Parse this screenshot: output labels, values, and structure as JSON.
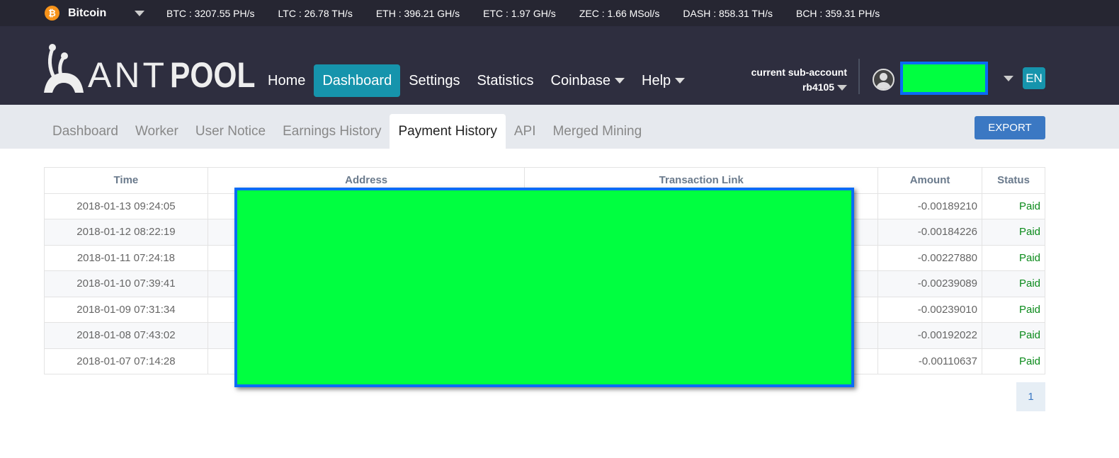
{
  "topbar": {
    "coin": "Bitcoin",
    "rates": [
      "BTC : 3207.55 PH/s",
      "LTC : 26.78 TH/s",
      "ETH : 396.21 GH/s",
      "ETC : 1.97 GH/s",
      "ZEC : 1.66 MSol/s",
      "DASH : 858.31 TH/s",
      "BCH : 359.31 PH/s"
    ]
  },
  "logo": {
    "ant": "ANT",
    "pool": "POOL"
  },
  "nav": {
    "home": "Home",
    "dashboard": "Dashboard",
    "settings": "Settings",
    "statistics": "Statistics",
    "coinbase": "Coinbase",
    "help": "Help"
  },
  "account": {
    "label": "current sub-account",
    "name": "rb4105",
    "lang": "EN"
  },
  "tabs": [
    "Dashboard",
    "Worker",
    "User Notice",
    "Earnings History",
    "Payment History",
    "API",
    "Merged Mining"
  ],
  "export": "EXPORT",
  "table": {
    "headers": [
      "Time",
      "Address",
      "Transaction Link",
      "Amount",
      "Status"
    ],
    "rows": [
      [
        "2018-01-13 09:24:05",
        "-0.00189210",
        "Paid"
      ],
      [
        "2018-01-12 08:22:19",
        "-0.00184226",
        "Paid"
      ],
      [
        "2018-01-11 07:24:18",
        "-0.00227880",
        "Paid"
      ],
      [
        "2018-01-10 07:39:41",
        "-0.00239089",
        "Paid"
      ],
      [
        "2018-01-09 07:31:34",
        "-0.00239010",
        "Paid"
      ],
      [
        "2018-01-08 07:43:02",
        "-0.00192022",
        "Paid"
      ],
      [
        "2018-01-07 07:14:28",
        "-0.00110637",
        "Paid"
      ]
    ]
  },
  "pagination": {
    "current": "1"
  }
}
